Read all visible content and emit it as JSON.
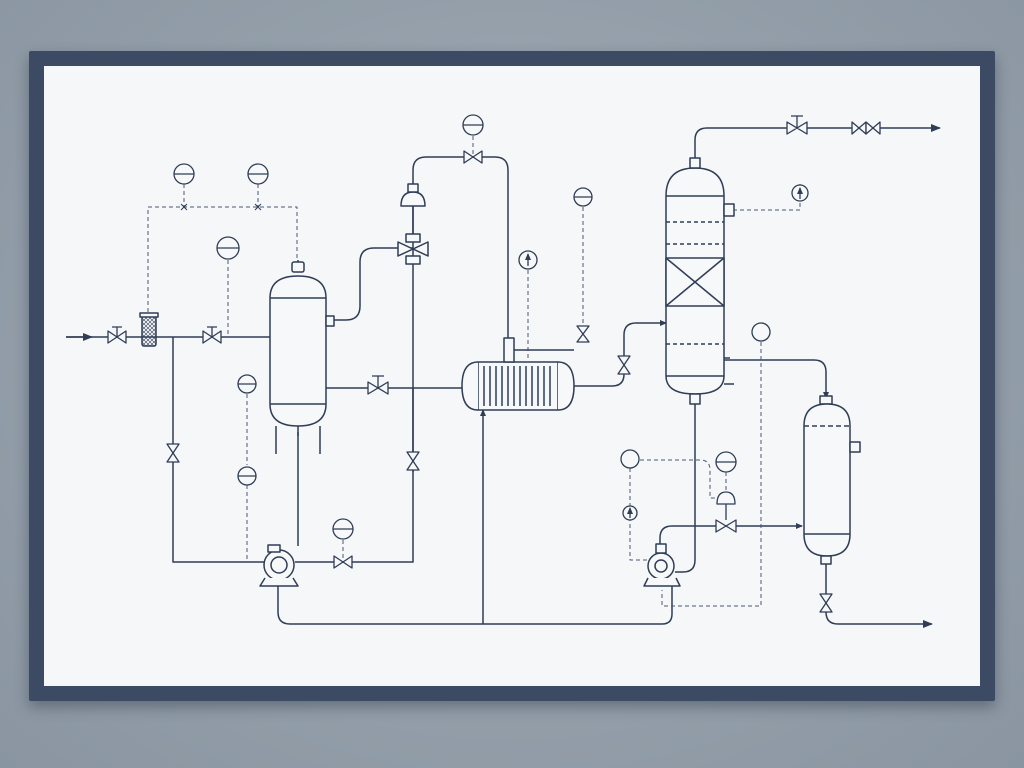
{
  "diagram": {
    "type": "process-flow-diagram",
    "colors": {
      "wall": "#939ea9",
      "frame": "#3c4a63",
      "paper": "#f6f7f8",
      "line": "#2f3d57",
      "signal": "#4a5a78"
    },
    "equipment": [
      {
        "name": "inlet-strainer",
        "icon": "strainer-icon"
      },
      {
        "name": "feed-drum",
        "icon": "vertical-vessel-icon"
      },
      {
        "name": "feed-pump",
        "icon": "centrifugal-pump-icon"
      },
      {
        "name": "control-valve",
        "icon": "diaphragm-valve-icon"
      },
      {
        "name": "heat-exchanger",
        "icon": "shell-and-tube-exchanger-icon"
      },
      {
        "name": "column",
        "icon": "packed-column-icon"
      },
      {
        "name": "bottoms-pump",
        "icon": "centrifugal-pump-icon"
      },
      {
        "name": "product-drum",
        "icon": "vertical-vessel-icon"
      }
    ],
    "instrument_count": 13,
    "valve_count": 15
  }
}
